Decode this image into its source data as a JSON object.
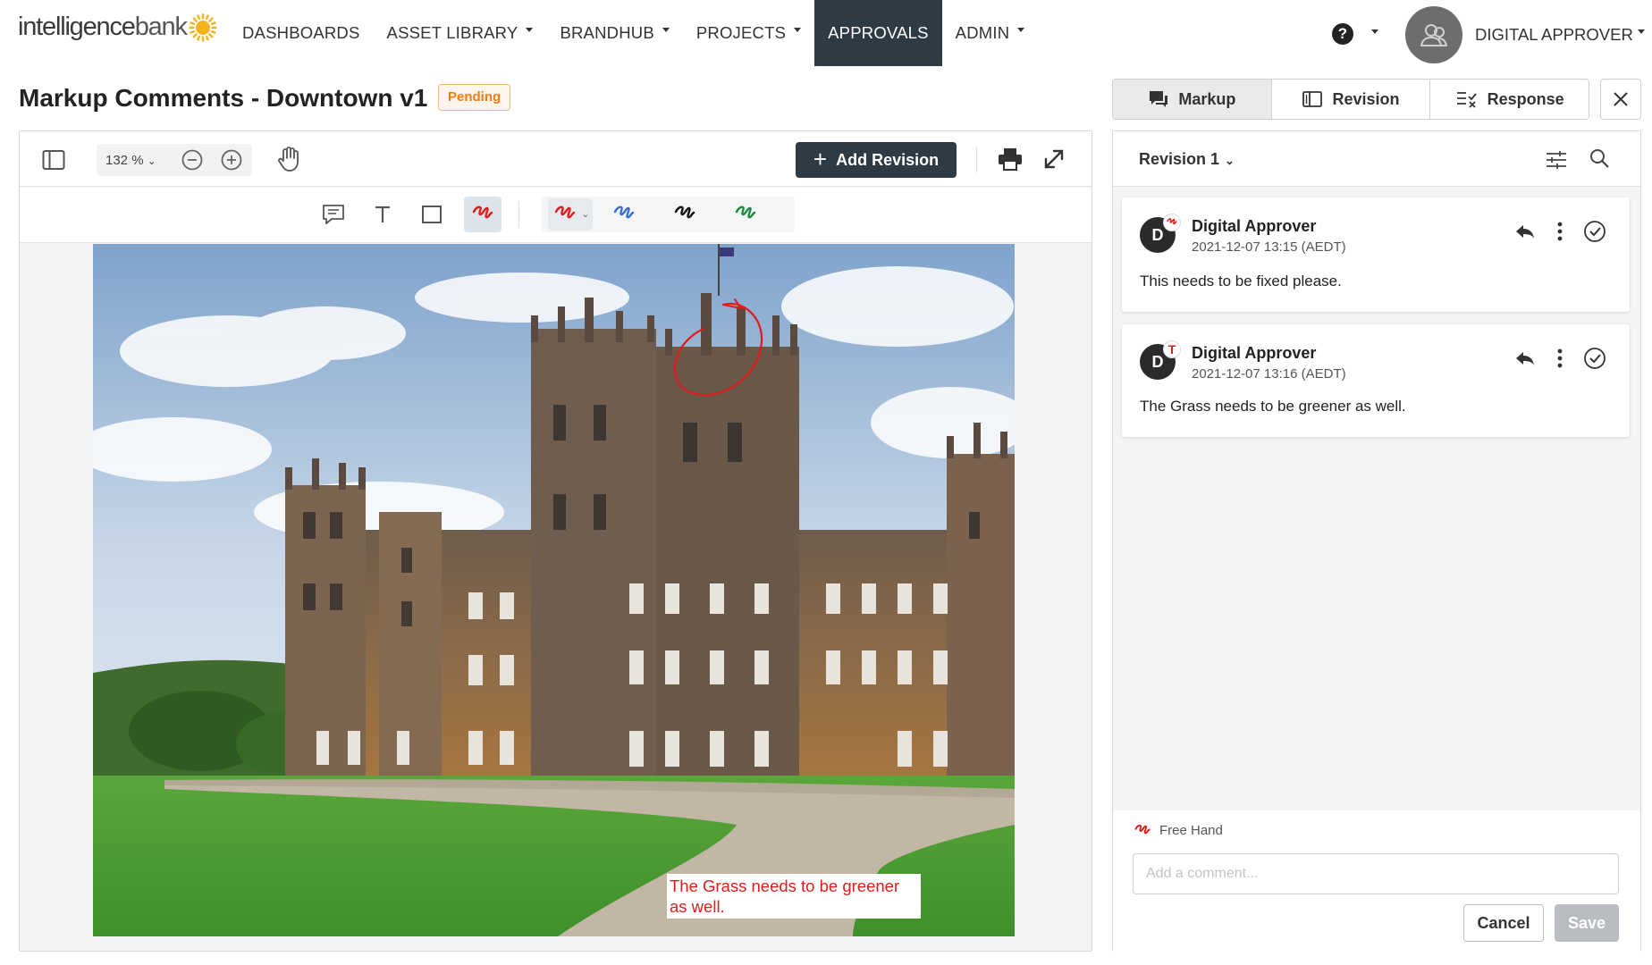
{
  "brand": {
    "name_part1": "intelligence",
    "name_part2": "bank"
  },
  "nav": {
    "items": [
      {
        "label": "DASHBOARDS",
        "dropdown": false,
        "active": false
      },
      {
        "label": "ASSET LIBRARY",
        "dropdown": true,
        "active": false
      },
      {
        "label": "BRANDHUB",
        "dropdown": true,
        "active": false
      },
      {
        "label": "PROJECTS",
        "dropdown": true,
        "active": false
      },
      {
        "label": "APPROVALS",
        "dropdown": false,
        "active": true
      },
      {
        "label": "ADMIN",
        "dropdown": true,
        "active": false
      }
    ],
    "help": "?",
    "user_name": "DIGITAL APPROVER"
  },
  "page": {
    "title": "Markup Comments - Downtown v1",
    "status_badge": "Pending"
  },
  "viewer": {
    "zoom": "132 %",
    "add_revision_label": "Add Revision",
    "annotation_text": "The Grass needs to be greener as well."
  },
  "panel": {
    "tabs": [
      {
        "label": "Markup",
        "icon": "chat-icon",
        "active": true
      },
      {
        "label": "Revision",
        "icon": "compare-icon",
        "active": false
      },
      {
        "label": "Response",
        "icon": "checklist-icon",
        "active": false
      }
    ],
    "revision_label": "Revision 1",
    "comments": [
      {
        "author": "Digital Approver",
        "initial": "D",
        "badge": "freehand-icon",
        "timestamp": "2021-12-07 13:15 (AEDT)",
        "text": "This needs to be fixed please."
      },
      {
        "author": "Digital Approver",
        "initial": "D",
        "badge": "T",
        "timestamp": "2021-12-07 13:16 (AEDT)",
        "text": "The Grass needs to be greener as well."
      }
    ],
    "composer": {
      "tool_label": "Free Hand",
      "placeholder": "Add a comment...",
      "cancel_label": "Cancel",
      "save_label": "Save"
    }
  },
  "colors": {
    "nav_active_bg": "#2e3b44",
    "badge_orange": "#f07d16",
    "markup_red": "#e21b1b",
    "pen_blue": "#3b6fd8",
    "pen_black": "#111111",
    "pen_green": "#1b8a3a"
  }
}
